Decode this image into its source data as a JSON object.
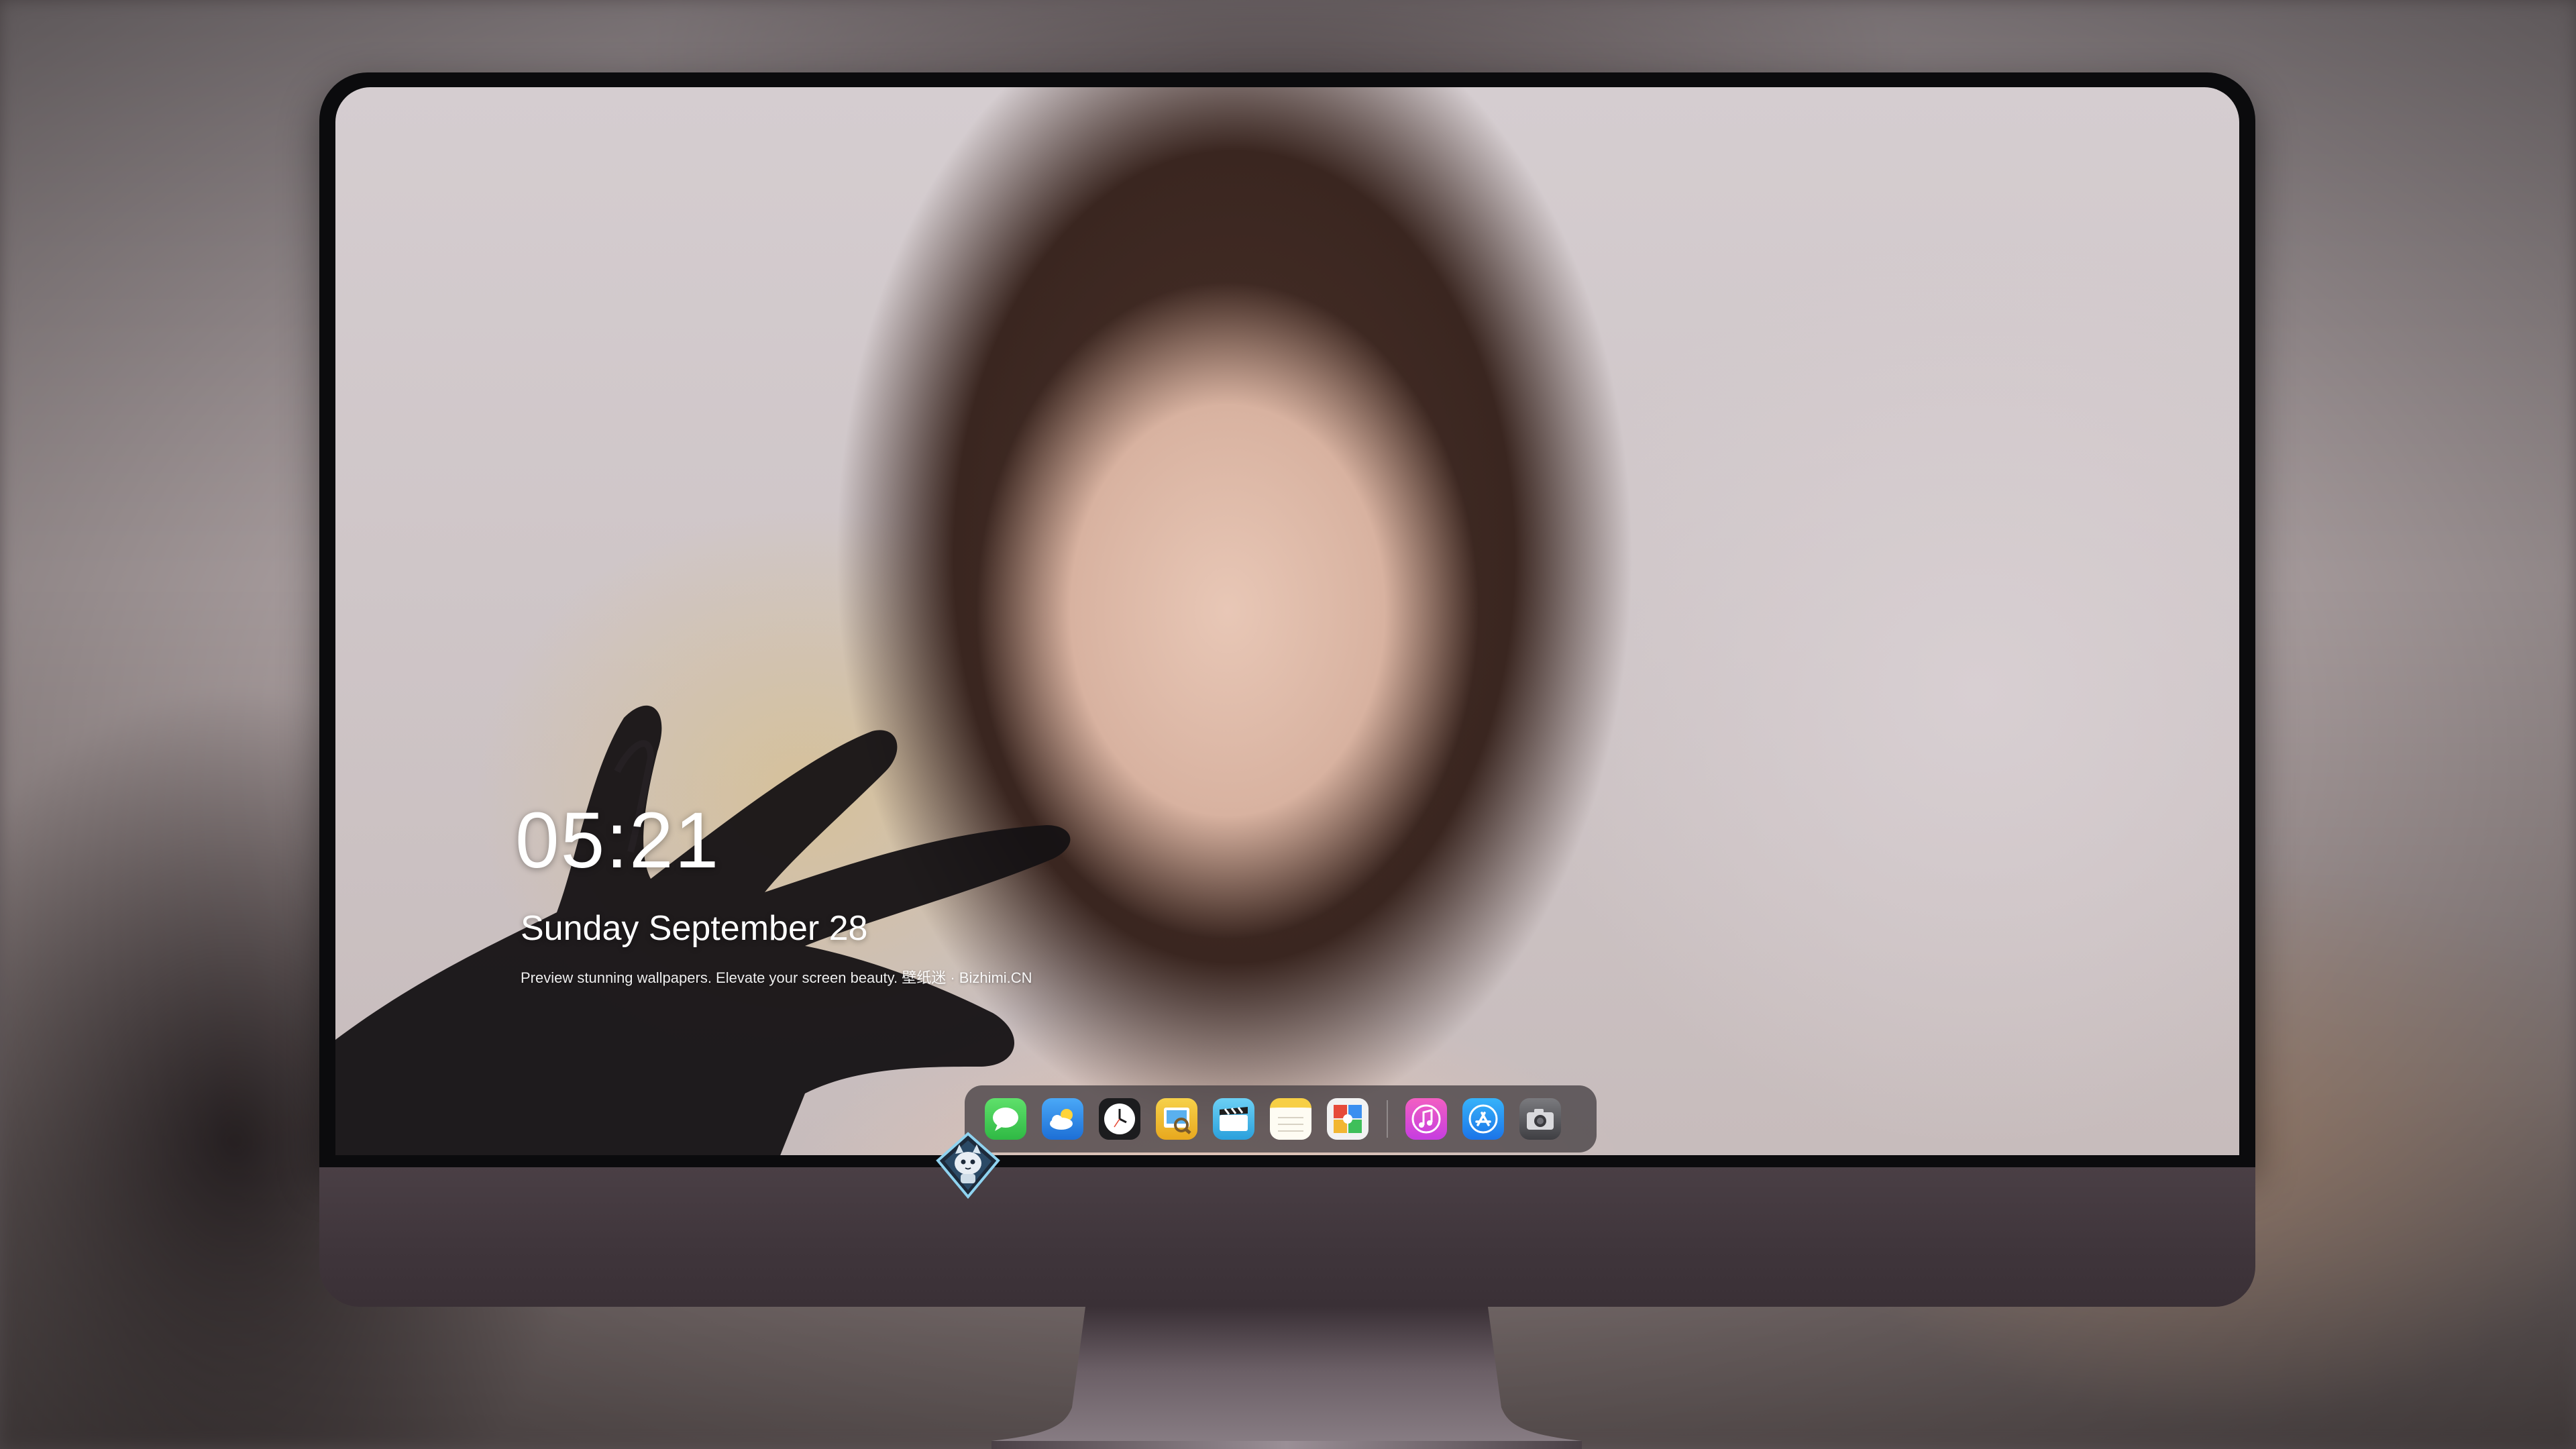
{
  "lockscreen": {
    "time": "05:21",
    "date": "Sunday September  28",
    "tagline": "Preview stunning wallpapers. Elevate your screen beauty. 壁纸迷 · Bizhimi.CN"
  },
  "dock": {
    "items": [
      {
        "id": "messages",
        "icon": "messages-icon",
        "color": "#3ecb4f"
      },
      {
        "id": "weather",
        "icon": "weather-icon",
        "color": "#2f8ff0"
      },
      {
        "id": "clock",
        "icon": "clock-icon",
        "color": "#1c1c1e"
      },
      {
        "id": "preview",
        "icon": "preview-icon",
        "color": "#f2c230"
      },
      {
        "id": "clips",
        "icon": "clips-icon",
        "color": "#3bb2e6"
      },
      {
        "id": "notes",
        "icon": "notes-icon",
        "color": "#f7d04a"
      },
      {
        "id": "photo-booth",
        "icon": "photo-booth-icon",
        "color": "#e64a3a"
      },
      {
        "id": "music",
        "icon": "music-icon",
        "color": "#e43fa9"
      },
      {
        "id": "app-store",
        "icon": "app-store-icon",
        "color": "#1f8ff0"
      },
      {
        "id": "camera",
        "icon": "camera-icon",
        "color": "#5a5a5e"
      }
    ]
  },
  "colors": {
    "bezel": "#0b0b0d",
    "chin": "#433940",
    "dock_bg": "#46404488"
  },
  "monitor": {
    "logo_icon": "fox-mascot-logo-icon"
  }
}
